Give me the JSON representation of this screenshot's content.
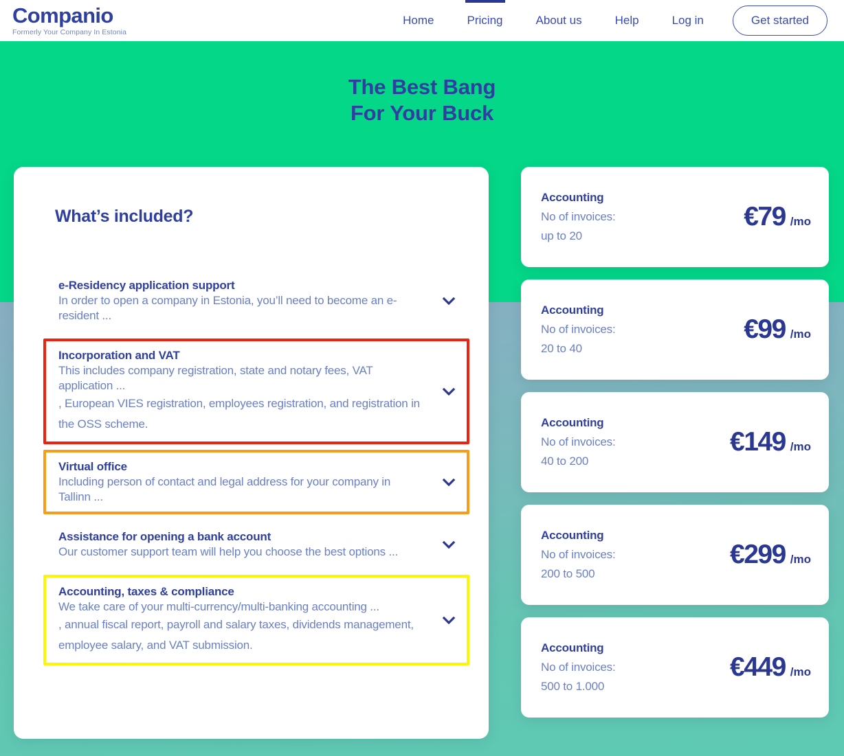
{
  "brand": {
    "name": "Companio",
    "tagline": "Formerly Your Company In Estonia",
    "primary_color": "#2f3fa0",
    "accent_green": "#04d787",
    "bg_top": "#94a6cb",
    "bg_bottom": "#5ecab3"
  },
  "nav": {
    "links": [
      {
        "label": "Home",
        "active": false
      },
      {
        "label": "Pricing",
        "active": true
      },
      {
        "label": "About us",
        "active": false
      },
      {
        "label": "Help",
        "active": false
      },
      {
        "label": "Log in",
        "active": false
      }
    ],
    "cta_label": "Get started"
  },
  "hero": {
    "line1": "The Best Bang",
    "line2": "For Your Buck"
  },
  "included": {
    "title": "What’s included?",
    "items": [
      {
        "title": "e-Residency application support",
        "desc": "In order to open a company in Estonia, you’ll need to become an e-resident ...",
        "extra": "",
        "highlight": "none",
        "chevron": "chevron-down-icon"
      },
      {
        "title": "Incorporation and VAT",
        "desc": "This includes company registration, state and notary fees, VAT application ...",
        "extra": ", European VIES registration, employees registration, and registration in the OSS scheme.",
        "highlight": "red",
        "highlight_color": "#ee2211",
        "chevron": "chevron-down-icon"
      },
      {
        "title": "Virtual office",
        "desc": "Including person of contact and legal address for your company in Tallinn ...",
        "extra": "",
        "highlight": "orange",
        "highlight_color": "#f79d19",
        "chevron": "chevron-down-icon"
      },
      {
        "title": "Assistance for opening a bank account",
        "desc": "Our customer support team will help you choose the best options ...",
        "extra": "",
        "highlight": "none",
        "chevron": "chevron-down-icon"
      },
      {
        "title": "Accounting, taxes & compliance",
        "desc": "We take care of your multi-currency/multi-banking accounting ...",
        "extra": ", annual fiscal report, payroll and salary taxes, dividends management, employee salary, and VAT submission.",
        "highlight": "yellow",
        "highlight_color": "#fbf606",
        "chevron": "chevron-down-icon"
      }
    ]
  },
  "pricing": {
    "cards": [
      {
        "plan": "Accounting",
        "invoices_label": "No of invoices:",
        "invoices_range": "up to 20",
        "price": "€79",
        "period": "/mo"
      },
      {
        "plan": "Accounting",
        "invoices_label": "No of invoices:",
        "invoices_range": "20 to 40",
        "price": "€99",
        "period": "/mo"
      },
      {
        "plan": "Accounting",
        "invoices_label": "No of invoices:",
        "invoices_range": "40 to 200",
        "price": "€149",
        "period": "/mo"
      },
      {
        "plan": "Accounting",
        "invoices_label": "No of invoices:",
        "invoices_range": "200 to 500",
        "price": "€299",
        "period": "/mo"
      },
      {
        "plan": "Accounting",
        "invoices_label": "No of invoices:",
        "invoices_range": "500 to 1.000",
        "price": "€449",
        "period": "/mo"
      }
    ]
  }
}
